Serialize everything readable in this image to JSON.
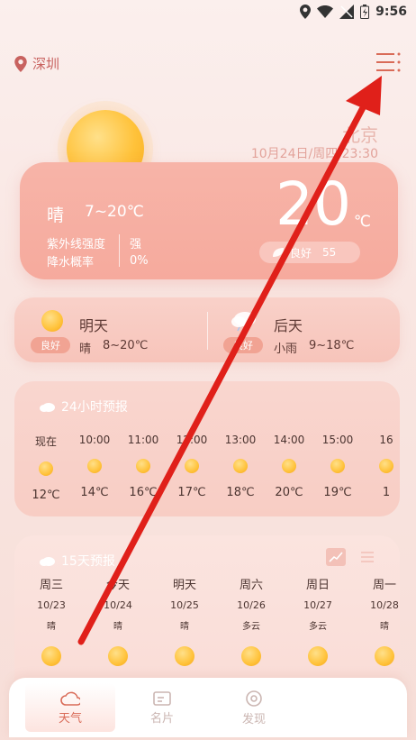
{
  "statusbar": {
    "time": "9:56"
  },
  "header": {
    "location": "深圳"
  },
  "current": {
    "city": "北京",
    "date": "10月24日/周四 23:30",
    "condition": "晴",
    "range": "7~20℃",
    "uv_label": "紫外线强度",
    "uv_value": "强",
    "rain_label": "降水概率",
    "rain_value": "0%",
    "temperature": "20",
    "unit": "℃",
    "aqi_label": "良好",
    "aqi_value": "55"
  },
  "tomorrow": {
    "name": "明天",
    "badge": "良好",
    "condition": "晴",
    "range": "8~20℃"
  },
  "dayafter": {
    "name": "后天",
    "badge": "良好",
    "condition": "小雨",
    "range": "9~18℃"
  },
  "hourly": {
    "title": "24小时预报",
    "items": [
      {
        "time": "现在",
        "temp": "12℃"
      },
      {
        "time": "10:00",
        "temp": "14℃"
      },
      {
        "time": "11:00",
        "temp": "16℃"
      },
      {
        "time": "12:00",
        "temp": "17℃"
      },
      {
        "time": "13:00",
        "temp": "18℃"
      },
      {
        "time": "14:00",
        "temp": "20℃"
      },
      {
        "time": "15:00",
        "temp": "19℃"
      },
      {
        "time": "16",
        "temp": "1"
      }
    ]
  },
  "daily": {
    "title": "15天预报",
    "items": [
      {
        "week": "周三",
        "date": "10/23",
        "cond": "晴"
      },
      {
        "week": "今天",
        "date": "10/24",
        "cond": "晴"
      },
      {
        "week": "明天",
        "date": "10/25",
        "cond": "晴"
      },
      {
        "week": "周六",
        "date": "10/26",
        "cond": "多云"
      },
      {
        "week": "周日",
        "date": "10/27",
        "cond": "多云"
      },
      {
        "week": "周一",
        "date": "10/28",
        "cond": "晴"
      }
    ]
  },
  "tabs": {
    "weather": "天气",
    "card": "名片",
    "discover": "发现"
  },
  "colors": {
    "accent": "#d96b58",
    "arrow": "#e0201a"
  }
}
